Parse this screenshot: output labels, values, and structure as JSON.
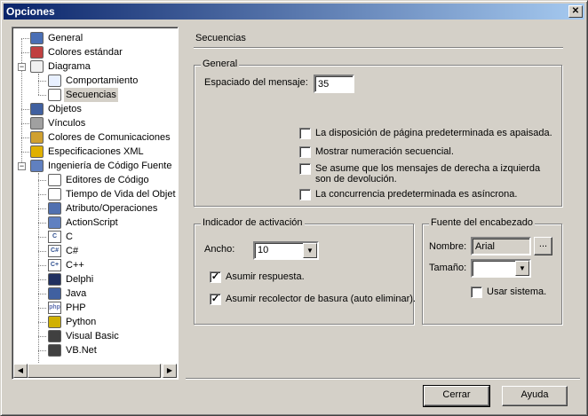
{
  "window": {
    "title": "Opciones",
    "close_glyph": "✕"
  },
  "tree": {
    "items": [
      {
        "label": "General",
        "icon": "general-icon",
        "color": "#4a6fb5"
      },
      {
        "label": "Colores estándar",
        "icon": "colors-icon",
        "color": "#c04040"
      },
      {
        "label": "Diagrama",
        "icon": "diagram-icon",
        "color": "#f0f0f0"
      },
      {
        "label": "Comportamiento",
        "icon": "behavior-icon",
        "color": "#e8f0ff"
      },
      {
        "label": "Secuencias",
        "icon": "sequence-icon",
        "color": "#ffffff"
      },
      {
        "label": "Objetos",
        "icon": "objects-icon",
        "color": "#4060a0"
      },
      {
        "label": "Vínculos",
        "icon": "links-icon",
        "color": "#a0a0a0"
      },
      {
        "label": "Colores de Comunicaciones",
        "icon": "comm-colors-icon",
        "color": "#d0a030"
      },
      {
        "label": "Especificaciones XML",
        "icon": "xml-icon",
        "color": "#e0b000"
      },
      {
        "label": "Ingeniería de Código Fuente",
        "icon": "source-engineering-icon",
        "color": "#6080c0"
      },
      {
        "label": "Editores de Código",
        "icon": "code-editor-icon",
        "color": "#ffffff"
      },
      {
        "label": "Tiempo de Vida del Objeto",
        "icon": "lifetime-icon",
        "color": "#ffffff"
      },
      {
        "label": "Atributo/Operaciones",
        "icon": "attribute-icon",
        "color": "#5070b0"
      },
      {
        "label": "ActionScript",
        "icon": "actionscript-icon",
        "color": "#6080c0"
      },
      {
        "label": "C",
        "icon": "c-lang-icon",
        "color": "#305090"
      },
      {
        "label": "C#",
        "icon": "csharp-icon",
        "color": "#305090"
      },
      {
        "label": "C++",
        "icon": "cpp-icon",
        "color": "#305090"
      },
      {
        "label": "Delphi",
        "icon": "delphi-icon",
        "color": "#203060"
      },
      {
        "label": "Java",
        "icon": "java-icon",
        "color": "#4060a0"
      },
      {
        "label": "PHP",
        "icon": "php-icon",
        "color": "#6070b0"
      },
      {
        "label": "Python",
        "icon": "python-icon",
        "color": "#d0b000"
      },
      {
        "label": "Visual Basic",
        "icon": "vb-icon",
        "color": "#404040"
      },
      {
        "label": "VB.Net",
        "icon": "vbnet-icon",
        "color": "#404040"
      }
    ],
    "php_glyph": "php",
    "c_glyph": "C",
    "cs_glyph": "C#",
    "cpp_glyph": "C+",
    "selected": "Secuencias"
  },
  "panel": {
    "title": "Secuencias",
    "general": {
      "legend": "General",
      "spacing_label": "Espaciado del mensaje:",
      "spacing_value": "35",
      "checkboxes": [
        {
          "label": "La disposición de página predeterminada es apaisada.",
          "checked": false
        },
        {
          "label": "Mostrar numeración secuencial.",
          "checked": false
        },
        {
          "label": "Se asume que los mensajes de derecha a izquierda",
          "label2": "son de devolución.",
          "checked": false
        },
        {
          "label": "La concurrencia predeterminada es asíncrona.",
          "checked": false
        }
      ]
    },
    "activation": {
      "legend": "Indicador de activación",
      "width_label": "Ancho:",
      "width_value": "10",
      "checkboxes": [
        {
          "label": "Asumir respuesta.",
          "checked": true
        },
        {
          "label": "Asumir recolector de basura (auto eliminar).",
          "checked": true
        }
      ]
    },
    "header_font": {
      "legend": "Fuente del encabezado",
      "name_label": "Nombre:",
      "name_value": "Arial",
      "browse_label": "...",
      "size_label": "Tamaño:",
      "size_value": "",
      "system_label": "Usar sistema.",
      "system_checked": false
    }
  },
  "buttons": {
    "close": "Cerrar",
    "help": "Ayuda"
  },
  "glyphs": {
    "check": "✓",
    "down": "▼",
    "left": "◀",
    "right": "▶",
    "plus": "+",
    "minus": "−"
  }
}
